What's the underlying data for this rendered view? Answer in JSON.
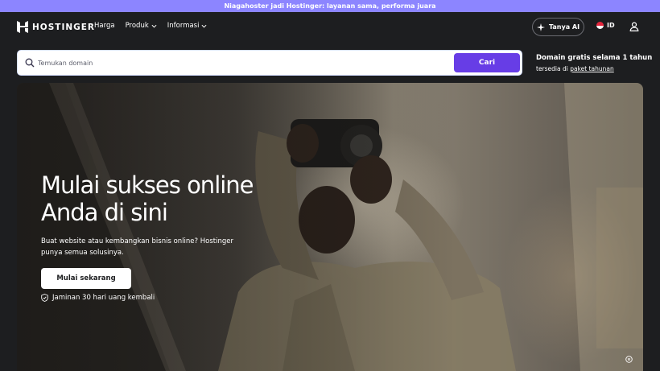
{
  "promo_bar": {
    "text": "Niagahoster jadi Hostinger: layanan sama, performa juara"
  },
  "header": {
    "logo_text": "HOSTINGER",
    "nav": [
      {
        "label": "Harga",
        "has_dropdown": false
      },
      {
        "label": "Produk",
        "has_dropdown": true
      },
      {
        "label": "Informasi",
        "has_dropdown": true
      }
    ],
    "ai_button_label": "Tanya AI",
    "language_code": "ID",
    "icons": {
      "logo": "hostinger-logo-icon",
      "ai": "sparkle-ai-icon",
      "flag": "indonesia-flag-icon",
      "user": "user-account-icon",
      "chevron": "chevron-down-icon"
    }
  },
  "search": {
    "placeholder": "Temukan domain",
    "value": "",
    "button_label": "Cari",
    "icon": "search-icon"
  },
  "domain_promo": {
    "title": "Domain gratis selama 1 tahun",
    "subtitle_prefix": "tersedia di",
    "link_label": "paket tahunan"
  },
  "hero": {
    "title_line1": "Mulai sukses online",
    "title_line2": "Anda di sini",
    "description": "Buat website atau kembangkan bisnis online? Hostinger punya semua solusinya.",
    "cta_label": "Mulai sekarang",
    "guarantee_text": "Jaminan 30 hari uang kembali",
    "guarantee_icon": "shield-check-icon",
    "media_control_icon": "pause-video-icon"
  },
  "colors": {
    "promo_bar": "#8c85ff",
    "primary_button": "#673de6",
    "page_background": "#1d1e20",
    "text_light": "#ffffff"
  }
}
